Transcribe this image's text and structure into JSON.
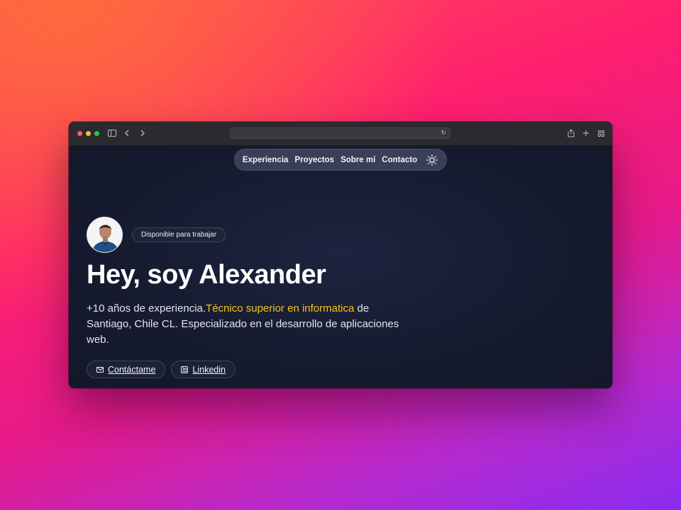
{
  "browser": {
    "url": "",
    "icons": [
      "sidebar-icon",
      "back-icon",
      "forward-icon",
      "reload-icon",
      "share-icon",
      "new-tab-icon",
      "tab-overview-icon"
    ]
  },
  "nav": {
    "items": [
      "Experiencia",
      "Proyectos",
      "Sobre mí",
      "Contacto"
    ],
    "theme_toggle_icon": "sun-icon"
  },
  "hero": {
    "status_badge": "Disponible para trabajar",
    "title": "Hey, soy Alexander",
    "description_before": "+10 años de experiencia.",
    "description_highlight": "Técnico superior en informatica",
    "description_after": " de Santiago, Chile CL. Especializado en el desarrollo de aplicaciones web.",
    "buttons": [
      {
        "label": "Contáctame",
        "icon": "mail-icon"
      },
      {
        "label": "Linkedin",
        "icon": "linkedin-icon"
      }
    ]
  },
  "colors": {
    "highlight": "#f5c518",
    "page_background": "#161b30",
    "nav_pill": "#3a3f58"
  }
}
